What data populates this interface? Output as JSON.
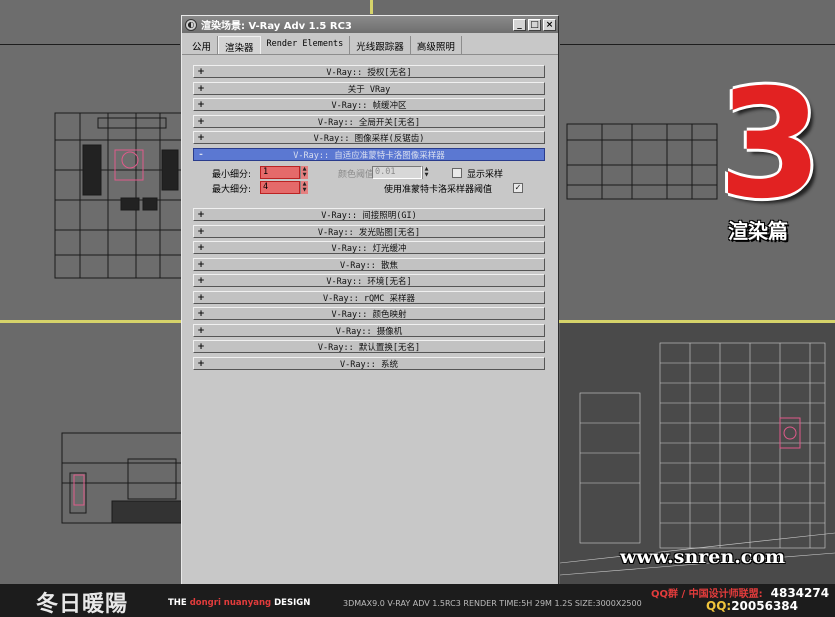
{
  "window": {
    "title": "渲染场景: V-Ray Adv 1.5 RC3",
    "buttons": {
      "minimize": "_",
      "maximize": "□",
      "close": "×"
    }
  },
  "tabs": [
    {
      "label": "公用",
      "active": false
    },
    {
      "label": "渲染器",
      "active": true
    },
    {
      "label": "Render Elements",
      "active": false
    },
    {
      "label": "光线跟踪器",
      "active": false
    },
    {
      "label": "高级照明",
      "active": false
    }
  ],
  "rollouts_top": [
    {
      "sign": "+",
      "label": "V-Ray:: 授权[无名]"
    },
    {
      "sign": "+",
      "label": "关于 VRay"
    },
    {
      "sign": "+",
      "label": "V-Ray:: 帧缓冲区"
    },
    {
      "sign": "+",
      "label": "V-Ray:: 全局开关[无名]"
    },
    {
      "sign": "+",
      "label": "V-Ray:: 图像采样(反锯齿)"
    }
  ],
  "open_rollout": {
    "sign": "-",
    "label": "V-Ray:: 自适应准蒙特卡洛图像采样器"
  },
  "sampler": {
    "min_subdiv_label": "最小细分:",
    "min_subdiv_value": "1",
    "max_subdiv_label": "最大细分:",
    "max_subdiv_value": "4",
    "color_thresh_label": "颜色阈值:",
    "color_thresh_value": "0.01",
    "show_samples_label": "显示采样",
    "use_qmc_label": "使用准蒙特卡洛采样器阈值",
    "use_qmc_check": "✓"
  },
  "rollouts_bottom": [
    {
      "sign": "+",
      "label": "V-Ray:: 间接照明(GI)"
    },
    {
      "sign": "+",
      "label": "V-Ray:: 发光贴图[无名]"
    },
    {
      "sign": "+",
      "label": "V-Ray:: 灯光缓冲"
    },
    {
      "sign": "+",
      "label": "V-Ray:: 散焦"
    },
    {
      "sign": "+",
      "label": "V-Ray:: 环境[无名]"
    },
    {
      "sign": "+",
      "label": "V-Ray:: rQMC 采样器"
    },
    {
      "sign": "+",
      "label": "V-Ray:: 颜色映射"
    },
    {
      "sign": "+",
      "label": "V-Ray:: 摄像机"
    },
    {
      "sign": "+",
      "label": "V-Ray:: 默认置换[无名]"
    },
    {
      "sign": "+",
      "label": "V-Ray:: 系统"
    }
  ],
  "overlay": {
    "number": "3",
    "chapter": "渲染篇",
    "website": "www.snren.com"
  },
  "banner": {
    "logo": "冬日暖陽",
    "brand_prefix": "THE ",
    "brand_highlight": "dongri nuanyang",
    "brand_suffix": " DESIGN",
    "tech_info": "3DMAX9.0  V-RAY ADV 1.5RC3   RENDER TIME:5H 29M 1.2S  SIZE:3000X2500",
    "qq_group_label": "QQ群 / 中国设计师联盟:",
    "qq_group_number": "4834274",
    "qq_label": "QQ:",
    "qq_number": "20056384"
  },
  "colors": {
    "rollout_open": "#5b78d2",
    "spinner_highlight": "#e56a6a",
    "accent_red": "#e22222",
    "viewport_border": "#d6d36a"
  }
}
